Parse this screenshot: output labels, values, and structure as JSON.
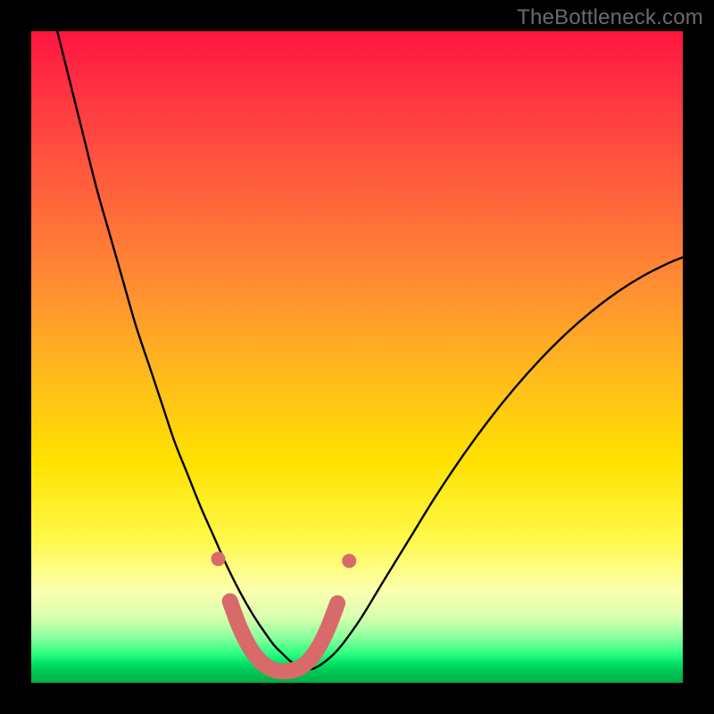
{
  "watermark": "TheBottleneck.com",
  "colors": {
    "frame": "#000000",
    "curve": "#000000",
    "marker_fill": "#d86a6a",
    "marker_stroke": "#c94f4f"
  },
  "chart_data": {
    "type": "line",
    "title": "",
    "xlabel": "",
    "ylabel": "",
    "xlim": [
      0,
      100
    ],
    "ylim": [
      0,
      100
    ],
    "grid": false,
    "legend": false,
    "series": [
      {
        "name": "bottleneck-curve",
        "x": [
          4,
          6,
          8,
          10,
          12,
          14,
          16,
          18,
          20,
          22,
          24,
          26,
          28,
          30,
          32,
          34,
          36,
          38,
          42,
          46,
          50,
          54,
          58,
          62,
          66,
          70,
          74,
          78,
          82,
          86,
          90,
          94,
          98,
          100
        ],
        "y": [
          100,
          92,
          84,
          76,
          69,
          62,
          55,
          49,
          43,
          37,
          32,
          27,
          22.5,
          18,
          14,
          10.5,
          7.5,
          5,
          2,
          4,
          9,
          15.5,
          22,
          28.5,
          34.5,
          40,
          45,
          49.5,
          53.5,
          57,
          60,
          62.5,
          64.5,
          65.3
        ]
      }
    ],
    "markers": {
      "name": "optimal-range",
      "style": "thick-rounded",
      "x": [
        30.5,
        32,
        33.5,
        35,
        36.5,
        38,
        39.5,
        41,
        42.5,
        44,
        45.5,
        47
      ],
      "y": [
        12.5,
        8.5,
        5.5,
        3.5,
        2.3,
        1.8,
        1.8,
        2.2,
        3.3,
        5.3,
        8.3,
        12.2
      ]
    }
  }
}
